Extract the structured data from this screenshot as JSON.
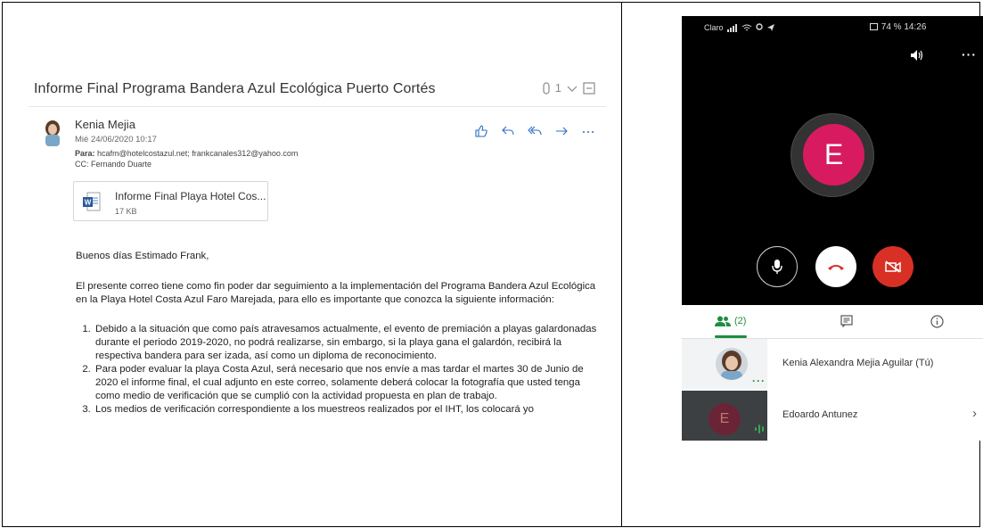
{
  "email": {
    "subject": "Informe Final Programa Bandera Azul Ecológica Puerto Cortés",
    "count": "1",
    "sender": "Kenia Mejia",
    "date": "Mié 24/06/2020 10:17",
    "to_label": "Para:",
    "to": "hcafm@hotelcostazul.net; frankcanales312@yahoo.com",
    "cc_label": "CC:",
    "cc": "Fernando Duarte",
    "attachment": {
      "name": "Informe Final Playa Hotel Cos...",
      "size": "17 KB",
      "icon": "word-doc-icon"
    },
    "greeting": "Buenos días Estimado Frank,",
    "intro": "El presente correo tiene como fin poder dar seguimiento a la implementación del Programa Bandera Azul Ecológica en la Playa Hotel Costa Azul Faro Marejada, para ello es importante que conozca la siguiente información:",
    "items": [
      "Debido a la situación que como país atravesamos actualmente, el evento de premiación a playas galardonadas durante el periodo 2019-2020, no podrá realizarse, sin embargo, si la playa gana el galardón, recibirá la respectiva bandera para ser izada, así como un diploma de reconocimiento.",
      "Para poder evaluar la playa Costa Azul, será necesario que nos envíe a mas tardar el martes 30 de Junio de 2020 el informe final, el cual adjunto en este correo, solamente deberá colocar la fotografía que usted tenga como medio de verificación que se cumplió con la actividad propuesta en plan de trabajo.",
      "Los medios de verificación correspondiente a los muestreos realizados por el IHT, los colocará yo"
    ],
    "accent_color": "#2b6cc4"
  },
  "call": {
    "status_left": "Claro",
    "status_right": "74 %  14:26",
    "caller_initial": "E",
    "avatar_color": "#d81b60",
    "hangup_color": "#d93025",
    "tabs": {
      "people": "(2)"
    },
    "participants": [
      {
        "name": "Kenia Alexandra Mejia Aguilar (Tú)"
      },
      {
        "name": "Edoardo Antunez",
        "initial": "E"
      }
    ],
    "accent_color": "#1e8e3e"
  }
}
